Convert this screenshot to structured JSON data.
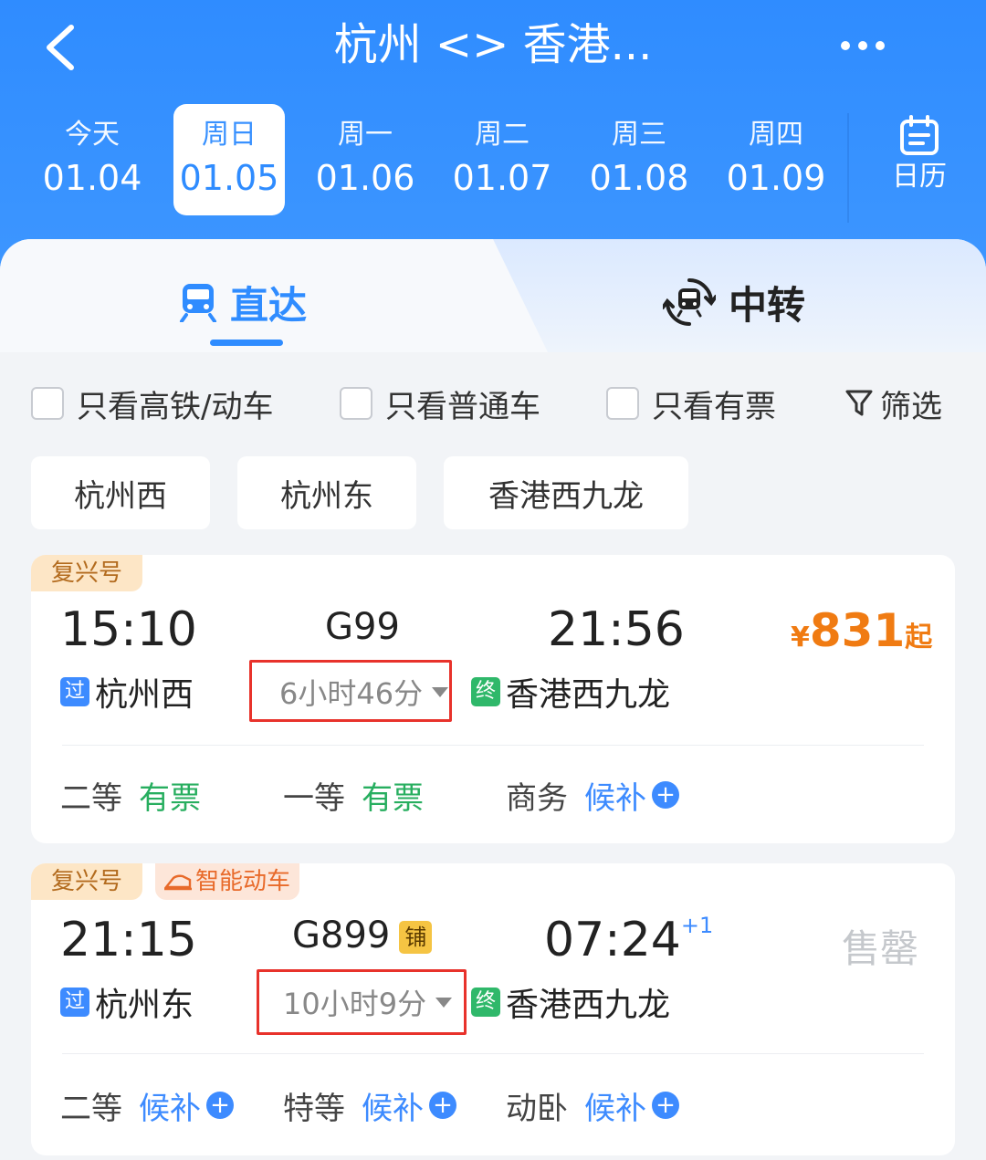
{
  "header": {
    "title": "杭州 <> 香港...",
    "dates": [
      {
        "weekday": "今天",
        "date": "01.04",
        "selected": false
      },
      {
        "weekday": "周日",
        "date": "01.05",
        "selected": true
      },
      {
        "weekday": "周一",
        "date": "01.06",
        "selected": false
      },
      {
        "weekday": "周二",
        "date": "01.07",
        "selected": false
      },
      {
        "weekday": "周三",
        "date": "01.08",
        "selected": false
      },
      {
        "weekday": "周四",
        "date": "01.09",
        "selected": false
      }
    ],
    "calendar_label": "日历"
  },
  "tabs": {
    "direct": "直达",
    "transfer": "中转"
  },
  "filters": {
    "high_speed": "只看高铁/动车",
    "regular": "只看普通车",
    "available": "只看有票",
    "filter_label": "筛选"
  },
  "stations": [
    "杭州西",
    "杭州东",
    "香港西九龙"
  ],
  "trains": [
    {
      "badges": [
        "复兴号"
      ],
      "depart_time": "15:10",
      "train_no": "G99",
      "arrive_time": "21:56",
      "depart_tag": "过",
      "depart_station": "杭州西",
      "duration": "6小时46分",
      "arrive_tag": "终",
      "arrive_station": "香港西九龙",
      "price_symbol": "¥",
      "price": "831",
      "price_suffix": "起",
      "seats": [
        {
          "class": "二等",
          "status": "有票"
        },
        {
          "class": "一等",
          "status": "有票"
        },
        {
          "class": "商务",
          "status": "候补"
        }
      ]
    },
    {
      "badges": [
        "复兴号",
        "智能动车"
      ],
      "depart_time": "21:15",
      "train_no": "G899",
      "train_tag": "铺",
      "arrive_time": "07:24",
      "arrive_day_offset": "+1",
      "depart_tag": "过",
      "depart_station": "杭州东",
      "duration": "10小时9分",
      "arrive_tag": "终",
      "arrive_station": "香港西九龙",
      "status": "售罄",
      "seats": [
        {
          "class": "二等",
          "status": "候补"
        },
        {
          "class": "特等",
          "status": "候补"
        },
        {
          "class": "动卧",
          "status": "候补"
        }
      ]
    }
  ],
  "colors": {
    "header_blue": "#2f8cff",
    "available_green": "#27ae5f",
    "waitlist_blue": "#3d8bff",
    "price_orange": "#f07b12",
    "highlight_red": "#e8322b"
  }
}
